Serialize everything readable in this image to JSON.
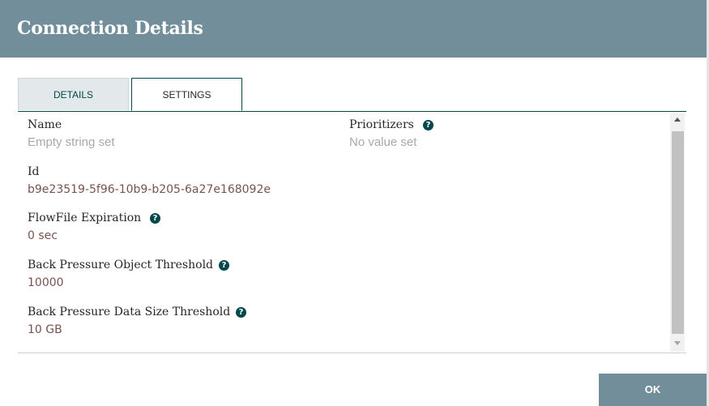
{
  "dialog": {
    "title": "Connection Details"
  },
  "tabs": [
    {
      "label": "DETAILS",
      "active": false
    },
    {
      "label": "SETTINGS",
      "active": true
    }
  ],
  "settings": {
    "name": {
      "label": "Name",
      "value": "Empty string set"
    },
    "id": {
      "label": "Id",
      "value": "b9e23519-5f96-10b9-b205-6a27e168092e"
    },
    "flowfile_expiration": {
      "label": "FlowFile Expiration",
      "value": "0 sec"
    },
    "back_pressure_object": {
      "label": "Back Pressure Object Threshold",
      "value": "10000"
    },
    "back_pressure_size": {
      "label": "Back Pressure Data Size Threshold",
      "value": "10 GB"
    },
    "prioritizers": {
      "label": "Prioritizers",
      "value": "No value set"
    }
  },
  "help_icon_glyph": "?",
  "footer": {
    "ok_label": "OK"
  },
  "colors": {
    "header": "#728e9b",
    "accent": "#004849",
    "value": "#775351",
    "unset": "#a8a8a8"
  },
  "icons": [
    "help-icon",
    "scroll-up-arrow-icon",
    "scroll-down-arrow-icon"
  ]
}
